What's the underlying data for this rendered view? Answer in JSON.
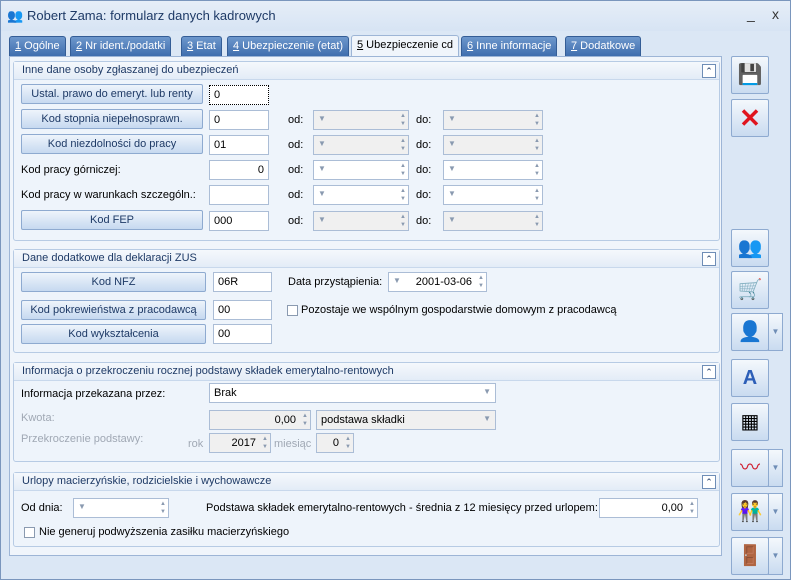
{
  "window": {
    "title": "Robert Zama: formularz danych kadrowych",
    "minimize": "_",
    "close": "x"
  },
  "tabs": [
    {
      "num": "1",
      "label": " Ogólne"
    },
    {
      "num": "2",
      "label": " Nr ident./podatki"
    },
    {
      "num": "3",
      "label": " Etat"
    },
    {
      "num": "4",
      "label": " Ubezpieczenie (etat)"
    },
    {
      "num": "5",
      "label": " Ubezpieczenie cd"
    },
    {
      "num": "6",
      "label": " Inne informacje"
    },
    {
      "num": "7",
      "label": " Dodatkowe"
    }
  ],
  "section1": {
    "title": "Inne dane osoby zgłaszanej do ubezpieczeń",
    "od": "od:",
    "do": "do:",
    "rows": [
      {
        "label": "Ustal. prawo do emeryt. lub renty",
        "value": "0"
      },
      {
        "label": "Kod stopnia niepełnosprawn.",
        "value": "0"
      },
      {
        "label": "Kod niezdolności do pracy",
        "value": "01"
      },
      {
        "label": "Kod pracy górniczej:",
        "value": "0"
      },
      {
        "label": "Kod pracy w warunkach szczególn.:",
        "value": ""
      },
      {
        "label": "Kod FEP",
        "value": "000"
      }
    ]
  },
  "section2": {
    "title": "Dane dodatkowe dla deklaracji ZUS",
    "kod_nfz": {
      "label": "Kod NFZ",
      "value": "06R"
    },
    "data_label": "Data przystąpienia:",
    "data_value": "2001-03-06",
    "pokrewienstwo": {
      "label": "Kod pokrewieństwa z pracodawcą",
      "value": "00"
    },
    "wspolne": "Pozostaje we wspólnym gospodarstwie domowym z pracodawcą",
    "wyksztalcenie": {
      "label": "Kod wykształcenia",
      "value": "00"
    }
  },
  "section3": {
    "title": "Informacja o przekroczeniu rocznej podstawy składek emerytalno-rentowych",
    "info_label": "Informacja przekazana przez:",
    "info_value": "Brak",
    "kwota_label": "Kwota:",
    "kwota_value": "0,00",
    "kwota_type": "podstawa składki",
    "przekr_label": "Przekroczenie podstawy:",
    "rok_label": "rok",
    "rok_value": "2017",
    "miesiac_label": "miesiąc",
    "miesiac_value": "0"
  },
  "section4": {
    "title": "Urlopy macierzyńskie, rodzicielskie i wychowawcze",
    "od_dnia": "Od dnia:",
    "podstawa_label": "Podstawa składek emerytalno-rentowych - średnia z 12 miesięcy przed urlopem:",
    "podstawa_value": "0,00",
    "nie_generuj": "Nie generuj podwyższenia zasiłku macierzyńskiego"
  }
}
